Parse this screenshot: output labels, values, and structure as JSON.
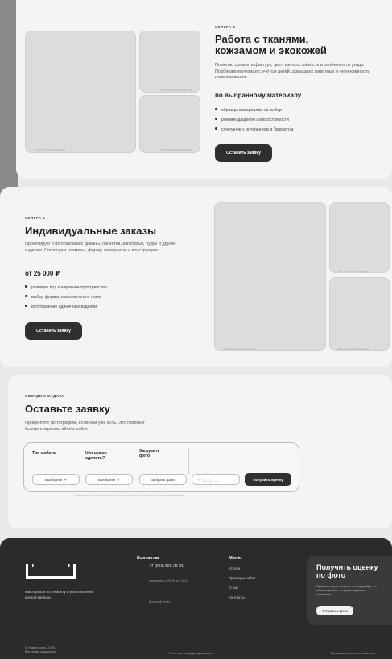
{
  "service4": {
    "eyebrow": "УСЛУГА 4",
    "title_line1": "Работа с тканями,",
    "title_line2": "кожзамом и экокожей",
    "description": "Помогаю сравнить фактуру, цвет, износостойкость и особенности ухода. Подбираю материал с учётом детей, домашних животных и интенсивности использования.",
    "price": "по выбранному материалу",
    "bullets": [
      "образцы материалов на выбор",
      "рекомендации по износостойкости",
      "сочетание с интерьером и бюджетом"
    ],
    "button": "Оставить заявку",
    "photo_caption": "ФОТОГРАФИЯ ИЗДЕЛИЯ"
  },
  "service5": {
    "eyebrow": "УСЛУГА 5",
    "title": "Индивидуальные заказы",
    "description": "Проектирую и изготавливаю диваны, банкетки, изголовья, пуфы и другие изделия. Согласуем размеры, форму, материалы и конструкцию.",
    "price": "от 25 000 ₽",
    "bullets": [
      "размеры под конкретное пространство",
      "выбор формы, наполнителя и ткани",
      "изготовление единичных изделий"
    ],
    "button": "Оставить заявку",
    "photo_caption": "ФОТОГРАФИЯ ИЗДЕЛИЯ"
  },
  "request": {
    "eyebrow": "ОБСУДИМ ЗАДАЧУ",
    "title": "Оставьте заявку",
    "description": "Прикрепите фотографии, если они уже есть. Это поможет быстрее оценить объём работ.",
    "form": {
      "label_type": "Тип мебели",
      "label_todo": "Что нужно сделать?",
      "label_photo": "Загрузите фото",
      "select_type": "Выберите",
      "select_todo": "Выберите",
      "file_button": "Выбрать файл",
      "phone_placeholder": "+7 (___) ___",
      "submit": "Получить оценку",
      "consent": "Нажимая кнопку «Получить оценку», вы соглашаетесь на обработку персональных данных"
    }
  },
  "footer": {
    "tagline": "Мастерская по ремонту и изготовлению мягкой мебели",
    "contacts_title": "Контакты",
    "phone": "+7 (923) 569-25-21",
    "hours": "ежедневно с 09:00 до 21:00",
    "fast_reply": "Быстрый ответ",
    "menu_title": "Меню",
    "menu": [
      "Услуги",
      "Примеры работ",
      "О нас",
      "Контакты"
    ],
    "cta_title": "Получить оценку по фото",
    "cta_text": "Пришлите фото мебели, и я подскажу, что можно сделать, и сориентирую по стоимости.",
    "cta_button": "Отправить фото",
    "copyright": "© Новая жизнь, 2026",
    "rights": "Все права защищены",
    "privacy": "Политика конфиденциальности",
    "terms": "Пользовательское соглашение"
  }
}
